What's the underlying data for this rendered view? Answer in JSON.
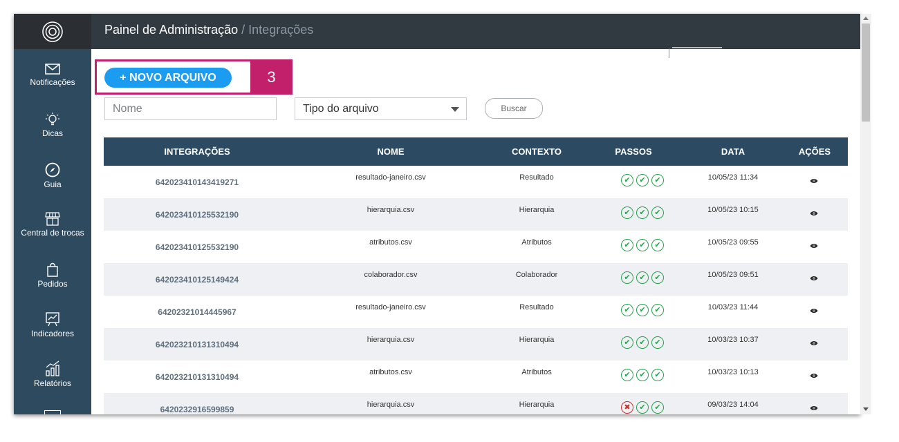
{
  "sidebar": {
    "items": [
      {
        "label": "Notificações",
        "icon": "mail-icon"
      },
      {
        "label": "Dicas",
        "icon": "lightbulb-icon"
      },
      {
        "label": "Guia",
        "icon": "compass-icon"
      },
      {
        "label": "Central de trocas",
        "icon": "store-icon"
      },
      {
        "label": "Pedidos",
        "icon": "shopping-bag-icon"
      },
      {
        "label": "Indicadores",
        "icon": "chart-board-icon"
      },
      {
        "label": "Relatórios",
        "icon": "bar-chart-icon"
      }
    ]
  },
  "header": {
    "title": "Painel de Administração",
    "separator": "/",
    "subtitle": "Integrações"
  },
  "toolbar": {
    "new_file_label": "+ NOVO ARQUIVO",
    "step_number": "3",
    "name_placeholder": "Nome",
    "file_type_value": "Tipo do arquivo",
    "search_label": "Buscar"
  },
  "table": {
    "headers": [
      "INTEGRAÇÕES",
      "NOME",
      "CONTEXTO",
      "PASSOS",
      "DATA",
      "AÇÕES"
    ],
    "rows": [
      {
        "id": "642023410143419271",
        "name": "resultado-janeiro.csv",
        "context": "Resultado",
        "date": "10/05/23 11:34",
        "steps": [
          "ok",
          "ok",
          "ok"
        ]
      },
      {
        "id": "642023410125532190",
        "name": "hierarquia.csv",
        "context": "Hierarquia",
        "date": "10/05/23 10:15",
        "steps": [
          "ok",
          "ok",
          "ok"
        ]
      },
      {
        "id": "642023410125532190",
        "name": "atributos.csv",
        "context": "Atributos",
        "date": "10/05/23 09:55",
        "steps": [
          "ok",
          "ok",
          "ok"
        ]
      },
      {
        "id": "642023410125149424",
        "name": "colaborador.csv",
        "context": "Colaborador",
        "date": "10/05/23 09:51",
        "steps": [
          "ok",
          "ok",
          "ok"
        ]
      },
      {
        "id": "64202321014445967",
        "name": "resultado-janeiro.csv",
        "context": "Resultado",
        "date": "10/03/23 11:44",
        "steps": [
          "ok",
          "ok",
          "ok"
        ]
      },
      {
        "id": "642023210131310494",
        "name": "hierarquia.csv",
        "context": "Hierarquia",
        "date": "10/03/23 10:37",
        "steps": [
          "ok",
          "ok",
          "ok"
        ]
      },
      {
        "id": "642023210131310494",
        "name": "atributos.csv",
        "context": "Atributos",
        "date": "10/03/23 10:13",
        "steps": [
          "ok",
          "ok",
          "ok"
        ]
      },
      {
        "id": "6420232916599859",
        "name": "hierarquia.csv",
        "context": "Hierarquia",
        "date": "09/03/23 14:04",
        "steps": [
          "fail",
          "ok",
          "ok"
        ]
      }
    ]
  },
  "colors": {
    "sidebar": "#2e4a5f",
    "topbar": "#323a41",
    "accent": "#1c9cf0",
    "highlight": "#c2206b",
    "table_header": "#2c4b62",
    "success": "#23a34a",
    "error": "#d02c2c"
  }
}
